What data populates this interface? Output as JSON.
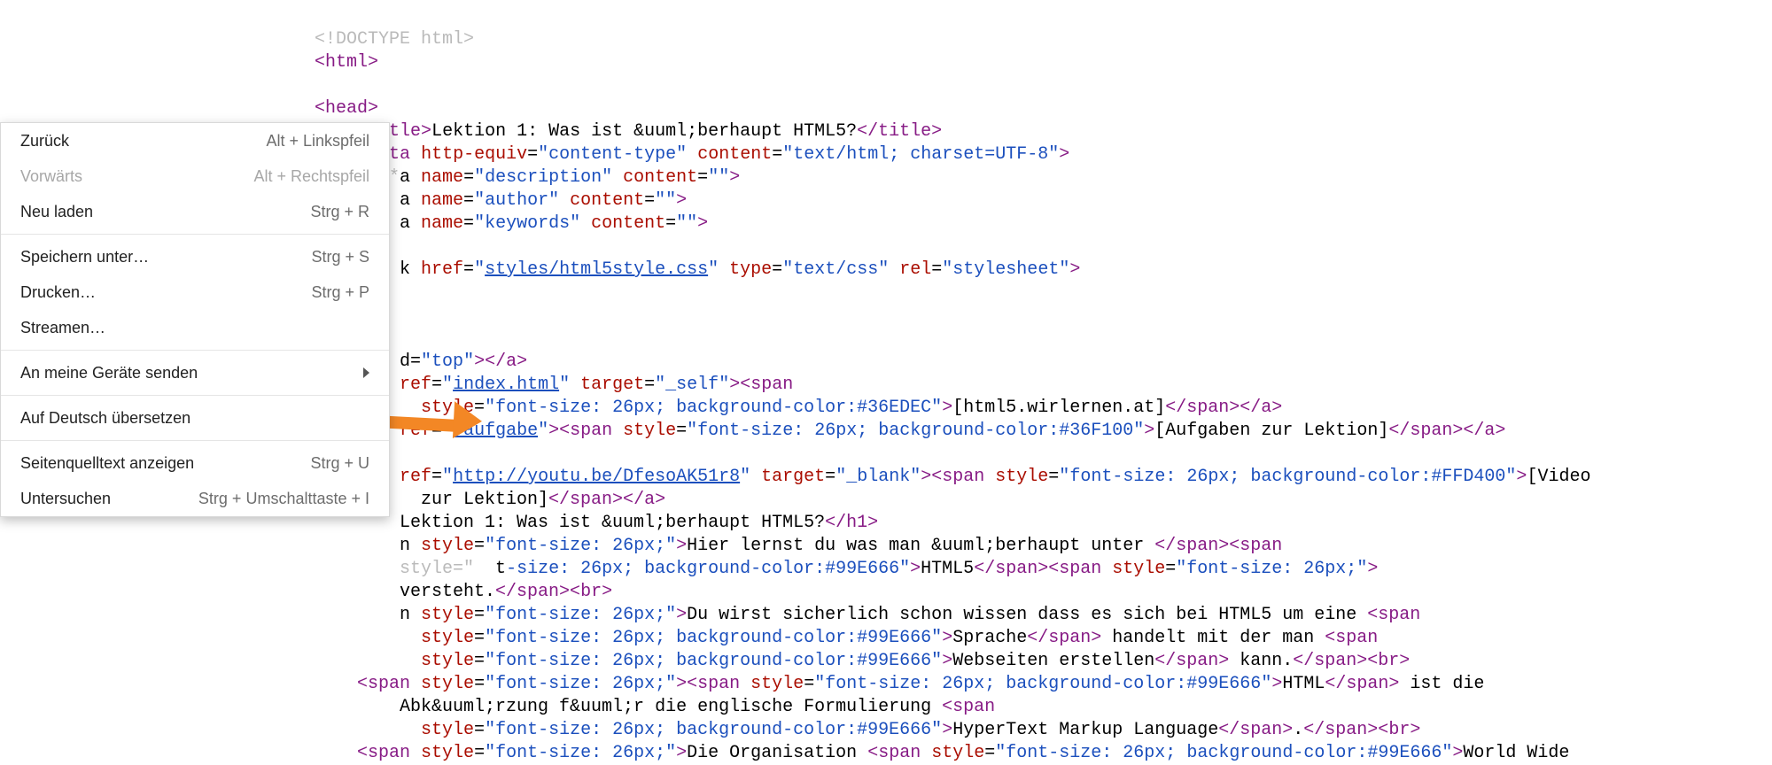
{
  "menu": {
    "items": [
      {
        "label": "Zurück",
        "shortcut": "Alt + Linkspfeil",
        "disabled": false
      },
      {
        "label": "Vorwärts",
        "shortcut": "Alt + Rechtspfeil",
        "disabled": true
      },
      {
        "label": "Neu laden",
        "shortcut": "Strg + R",
        "disabled": false
      }
    ],
    "items2": [
      {
        "label": "Speichern unter…",
        "shortcut": "Strg + S"
      },
      {
        "label": "Drucken…",
        "shortcut": "Strg + P"
      },
      {
        "label": "Streamen…",
        "shortcut": ""
      }
    ],
    "items3": [
      {
        "label": "An meine Geräte senden",
        "sub": true
      }
    ],
    "items4": [
      {
        "label": "Auf Deutsch übersetzen"
      }
    ],
    "items5": [
      {
        "label": "Seitenquelltext anzeigen",
        "shortcut": "Strg + U"
      },
      {
        "label": "Untersuchen",
        "shortcut": "Strg + Umschalttaste + I"
      }
    ]
  },
  "code": {
    "doctype": "<!DOCTYPE html>",
    "html_open": "html",
    "head_open": "head",
    "title_tag": "title",
    "title_text": "Lektion 1: Was ist &uuml;berhaupt HTML5?",
    "meta": "meta",
    "httpequiv": "http-equiv",
    "contenttype": "content-type",
    "content": "content",
    "contentval": "text/html; charset=UTF-8",
    "name": "name",
    "desc": "description",
    "author": "author",
    "keywords": "keywords",
    "href": "href",
    "linkpath": "styles/html5style.css",
    "type": "type",
    "textcss": "text/css",
    "rel": "rel",
    "stylesheet": "stylesheet",
    "dtop": "top",
    "ref": "ref",
    "index": "index.html",
    "target": "target",
    "self": "_self",
    "style": "style",
    "fs26": "font-size: 26px; background-color:#36EDEC",
    "site": "[html5.wirlernen.at]",
    "aufgabe": "#aufgabe",
    "fs26g": "font-size: 26px; background-color:#36F100",
    "aufgaben": "[Aufgaben zur Lektion]",
    "yt": "http://youtu.be/DfesoAK51r8",
    "blank": "_blank",
    "fs26y": "font-size: 26px; background-color:#FFD400",
    "video": "[Video\n          zur Lektion]",
    "lektion": "Lektion 1: Was ist &uuml;berhaupt HTML5?",
    "fs26p": "font-size: 26px;",
    "hier": "Hier lernst du was man &uuml;berhaupt unter ",
    "fs26o": "-size: 26px; background-color:#99E666",
    "html5": "HTML5",
    "versteht": " versteht.",
    "duwirst": "Du wirst sicherlich schon wissen dass es sich bei HTML5 um eine ",
    "fs26o2": "font-size: 26px; background-color:#99E666",
    "sprache": "Sprache",
    "handelt": " handelt mit der man ",
    "webseiten": "Webseiten erstellen",
    "kann": " kann.",
    "htmlword": "HTML",
    "istdie": " ist die\n        Abk&uuml;rzung f&uuml;r die englische Formulierung ",
    "hypertext": "HyperText Markup Language",
    "dot": ".",
    "dieorg": "Die Organisation ",
    "www": "World Wide"
  }
}
